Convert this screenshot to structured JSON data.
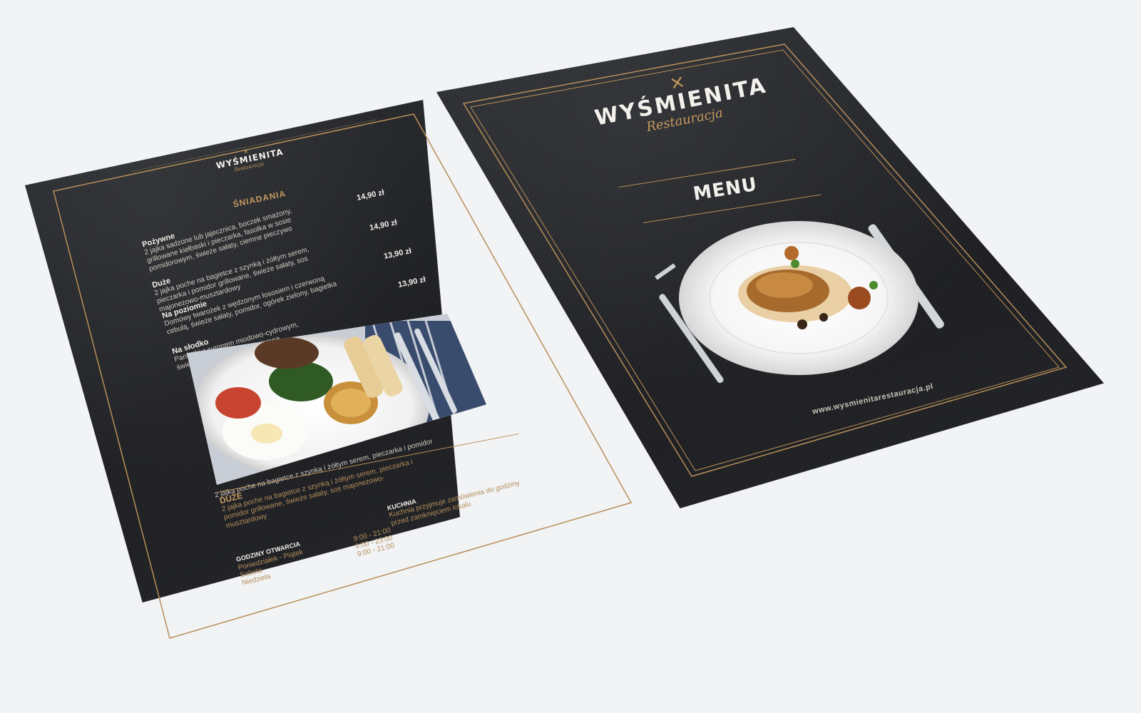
{
  "left_page": {
    "logo_text": "WYŚMIENITA",
    "logo_script": "Restauracja",
    "section_title": "ŚNIADANIA",
    "items": [
      {
        "title": "Pożywne",
        "description": "2 jajka sadzone lub jajecznica, boczek smażony, grillowane kiełbaski i pieczarka, fasolka w sosie pomidorowym, świeże sałaty, ciemne pieczywo",
        "price": "14,90 zł"
      },
      {
        "title": "Duże",
        "description": "2 jajka poche na bagietce z szynką i żółtym serem, pieczarka i pomidor grillowane, świeże sałaty, sos majonezowo-musztardowy",
        "price": "14,90 zł"
      },
      {
        "title": "Na poziomie",
        "description": "Domowy twarożek z wędzonym łososiem i czerwoną cebulą, świeże sałaty, pomidor, ogórek zielony, bagietka",
        "price": "13,90 zł"
      },
      {
        "title": "Na słodko",
        "description": "Pankejki z syropem miodowo-cydrowym, świeżymi owocami i bitą śmietaną",
        "price": "13,90 zł"
      }
    ],
    "photo_caption": "2 jajka poche na bagietce z szynką i żółtym serem, pieczarka i pomidor",
    "featured_title": "DUŻE",
    "featured_description": "2 jajka poche na bagietce z szynką i żółtym serem, pieczarka i pomidor grillowane, świeże sałaty, sos majonezowo-musztardowy",
    "kitchen_title": "KUCHNIA",
    "kitchen_text": "Kuchnia przyjmuje zamówienia do godziny przed zamknięciem lokalu",
    "hours_title": "GODZINY OTWARCIA",
    "hours": [
      {
        "day": "Poniedziałek - Piątek",
        "time": "9:00 - 21:00"
      },
      {
        "day": "Sobota",
        "time": "9:00 - 23:00"
      },
      {
        "day": "Niedziela",
        "time": "9:00 - 21:00"
      }
    ]
  },
  "right_page": {
    "logo_text": "WYŚMIENITA",
    "logo_script": "Restauracja",
    "menu_title": "MENU",
    "website": "www.wysmienitarestauracja.pl"
  },
  "colors": {
    "gold": "#c79a5f",
    "page": "#222326",
    "background": "#f2f3f5"
  }
}
